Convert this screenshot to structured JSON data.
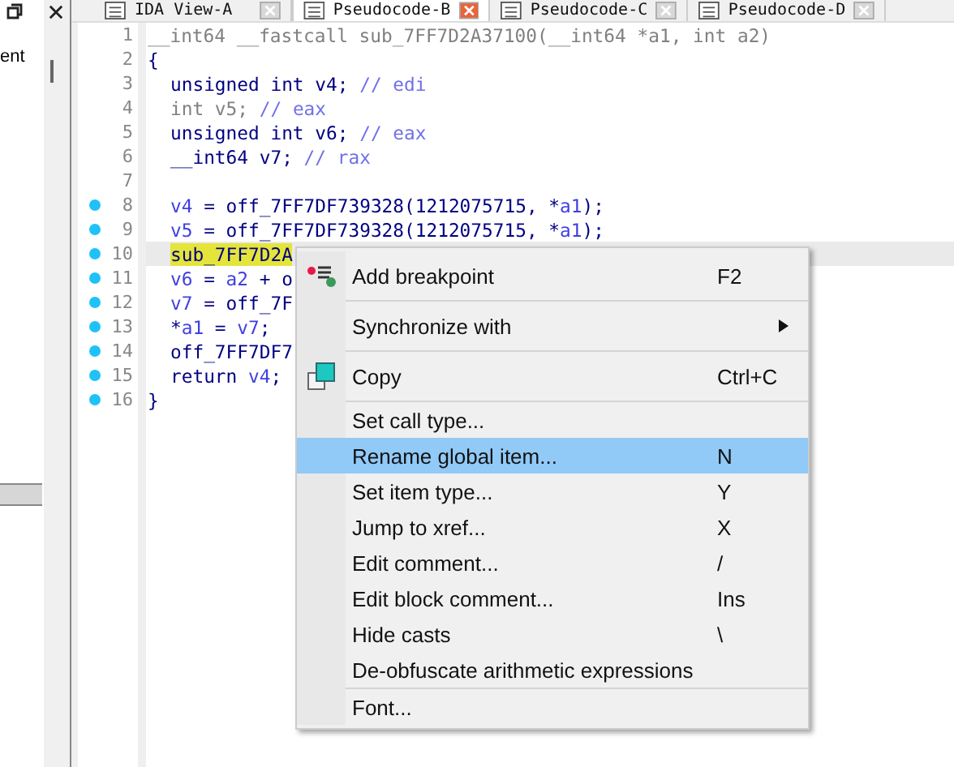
{
  "left_pane": {
    "items": [
      "ent"
    ]
  },
  "tabs": [
    {
      "label": "IDA View-A",
      "selected": false
    },
    {
      "label": "Pseudocode-B",
      "selected": true
    },
    {
      "label": "Pseudocode-C",
      "selected": false
    },
    {
      "label": "Pseudocode-D",
      "selected": false
    }
  ],
  "code": {
    "lines": [
      {
        "number": "1",
        "breakpoint": false,
        "current": false,
        "indented": false,
        "segments": [
          {
            "kind": "gray",
            "text": "__int64 __fastcall sub_7FF7D2A37100(__int64 *a1, int a2)"
          }
        ]
      },
      {
        "number": "2",
        "breakpoint": false,
        "current": false,
        "indented": false,
        "segments": [
          {
            "kind": "kw",
            "text": "{"
          }
        ]
      },
      {
        "number": "3",
        "breakpoint": false,
        "current": false,
        "indented": true,
        "segments": [
          {
            "kind": "kw",
            "text": "unsigned int v4; "
          },
          {
            "kind": "comment",
            "text": "// edi"
          }
        ]
      },
      {
        "number": "4",
        "breakpoint": false,
        "current": false,
        "indented": true,
        "segments": [
          {
            "kind": "gray",
            "text": "int v5; "
          },
          {
            "kind": "comment",
            "text": "// eax"
          }
        ]
      },
      {
        "number": "5",
        "breakpoint": false,
        "current": false,
        "indented": true,
        "segments": [
          {
            "kind": "kw",
            "text": "unsigned int v6; "
          },
          {
            "kind": "comment",
            "text": "// eax"
          }
        ]
      },
      {
        "number": "6",
        "breakpoint": false,
        "current": false,
        "indented": true,
        "segments": [
          {
            "kind": "kw",
            "text": "__int64 v7; "
          },
          {
            "kind": "comment",
            "text": "// rax"
          }
        ]
      },
      {
        "number": "7",
        "breakpoint": false,
        "current": false
      },
      {
        "number": "8",
        "breakpoint": true,
        "current": false,
        "indented": true,
        "segments": [
          {
            "kind": "var",
            "text": "v4"
          },
          {
            "kind": "kw",
            "text": " = off_7FF7DF739328(1212075715, *"
          },
          {
            "kind": "var",
            "text": "a1"
          },
          {
            "kind": "kw",
            "text": ");"
          }
        ]
      },
      {
        "number": "9",
        "breakpoint": true,
        "current": false,
        "indented": true,
        "segments": [
          {
            "kind": "var",
            "text": "v5"
          },
          {
            "kind": "kw",
            "text": " = off_7FF7DF739328(1212075715, *"
          },
          {
            "kind": "var",
            "text": "a1"
          },
          {
            "kind": "kw",
            "text": ");"
          }
        ]
      },
      {
        "number": "10",
        "breakpoint": true,
        "current": true,
        "indented": true,
        "segments": [
          {
            "kind": "highlight",
            "text": "sub_7FF7D2A"
          }
        ]
      },
      {
        "number": "11",
        "breakpoint": true,
        "current": false,
        "indented": true,
        "segments": [
          {
            "kind": "var",
            "text": "v6"
          },
          {
            "kind": "kw",
            "text": " = "
          },
          {
            "kind": "var",
            "text": "a2"
          },
          {
            "kind": "kw",
            "text": " + o"
          }
        ]
      },
      {
        "number": "12",
        "breakpoint": true,
        "current": false,
        "indented": true,
        "segments": [
          {
            "kind": "var",
            "text": "v7"
          },
          {
            "kind": "kw",
            "text": " = off_7F"
          }
        ]
      },
      {
        "number": "13",
        "breakpoint": true,
        "current": false,
        "indented": true,
        "segments": [
          {
            "kind": "kw",
            "text": "*"
          },
          {
            "kind": "var",
            "text": "a1"
          },
          {
            "kind": "kw",
            "text": " = "
          },
          {
            "kind": "var",
            "text": "v7"
          },
          {
            "kind": "kw",
            "text": ";"
          }
        ]
      },
      {
        "number": "14",
        "breakpoint": true,
        "current": false,
        "indented": true,
        "segments": [
          {
            "kind": "kw",
            "text": "off_7FF7DF7"
          }
        ]
      },
      {
        "number": "15",
        "breakpoint": true,
        "current": false,
        "indented": true,
        "segments": [
          {
            "kind": "kw",
            "text": "return "
          },
          {
            "kind": "var",
            "text": "v4"
          },
          {
            "kind": "kw",
            "text": ";"
          }
        ]
      },
      {
        "number": "16",
        "breakpoint": true,
        "current": false,
        "indented": false,
        "segments": [
          {
            "kind": "kw",
            "text": "}"
          }
        ]
      }
    ]
  },
  "context_menu": {
    "items": [
      {
        "kind": "breakpoint",
        "label": "Add breakpoint",
        "shortcut": "F2",
        "selected": false
      },
      {
        "kind": "separator"
      },
      {
        "kind": "submenu",
        "label": "Synchronize with",
        "selected": false
      },
      {
        "kind": "separator"
      },
      {
        "kind": "copy",
        "label": "Copy",
        "shortcut": "Ctrl+C",
        "selected": false
      },
      {
        "kind": "separator"
      },
      {
        "kind": "item",
        "label": "Set call type...",
        "selected": false
      },
      {
        "kind": "item",
        "label": "Rename global item...",
        "shortcut": "N",
        "selected": true
      },
      {
        "kind": "item",
        "label": "Set item type...",
        "shortcut": "Y",
        "selected": false
      },
      {
        "kind": "item",
        "label": "Jump to xref...",
        "shortcut": "X",
        "selected": false
      },
      {
        "kind": "item",
        "label": "Edit comment...",
        "shortcut": "/",
        "selected": false
      },
      {
        "kind": "item",
        "label": "Edit block comment...",
        "shortcut": "Ins",
        "selected": false
      },
      {
        "kind": "item",
        "label": "Hide casts",
        "shortcut": "\\",
        "selected": false
      },
      {
        "kind": "item",
        "label": "De-obfuscate arithmetic expressions",
        "selected": false
      },
      {
        "kind": "separator"
      },
      {
        "kind": "item",
        "label": "Font...",
        "selected": false
      }
    ]
  }
}
